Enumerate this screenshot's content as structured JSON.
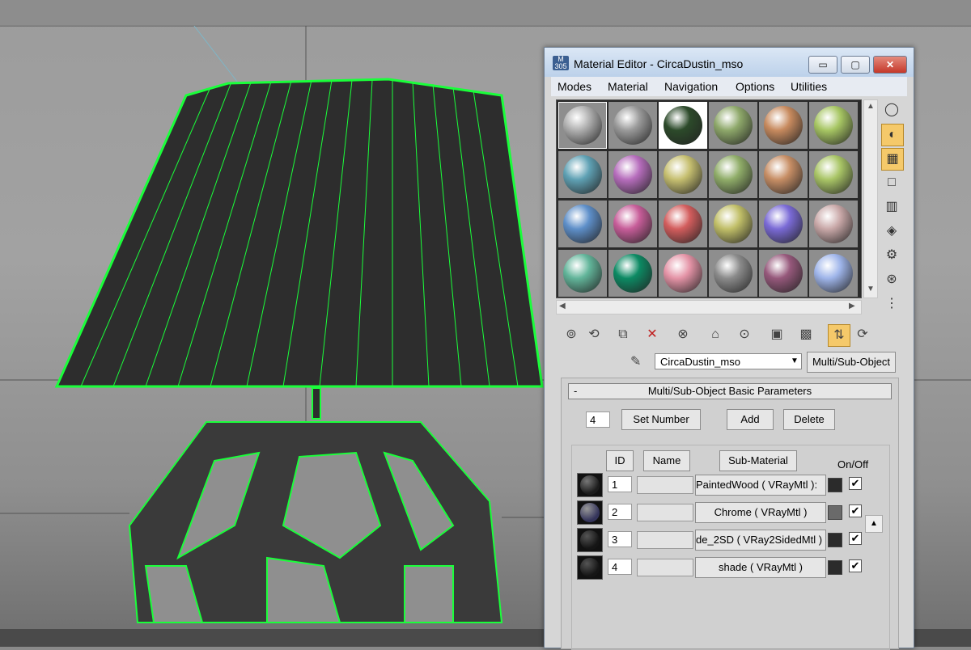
{
  "window": {
    "title": "Material Editor - CircaDustin_mso",
    "icon_label": "M 305",
    "buttons": {
      "minimize": "▭",
      "maximize": "▢",
      "close": "✕"
    }
  },
  "menu": [
    "Modes",
    "Material",
    "Navigation",
    "Options",
    "Utilities"
  ],
  "slots": [
    {
      "color": "#b0b0b0"
    },
    {
      "color": "#9a9a9a"
    },
    {
      "color": "#2c4a2a"
    },
    {
      "color": "#8ea86a"
    },
    {
      "color": "#c78a5e"
    },
    {
      "color": "#a7c663"
    },
    {
      "color": "#5fa1b4"
    },
    {
      "color": "#b66dbc"
    },
    {
      "color": "#c6bf70"
    },
    {
      "color": "#90ad69"
    },
    {
      "color": "#c78e65"
    },
    {
      "color": "#a9c566"
    },
    {
      "color": "#5e8fc9"
    },
    {
      "color": "#c75d99"
    },
    {
      "color": "#d35d5d"
    },
    {
      "color": "#c1bf68"
    },
    {
      "color": "#7a6ad6"
    },
    {
      "color": "#c9a8a8"
    },
    {
      "color": "#62b59a"
    },
    {
      "color": "#0c8a63"
    },
    {
      "color": "#e493a6"
    },
    {
      "color": "#8b8b8b"
    },
    {
      "color": "#96587b"
    },
    {
      "color": "#9fb5ea"
    }
  ],
  "material_name": "CircaDustin_mso",
  "material_type": "Multi/Sub-Object",
  "rollout": {
    "title": "Multi/Sub-Object Basic Parameters",
    "collapse": "-",
    "count": "4",
    "set_number": "Set Number",
    "add": "Add",
    "delete": "Delete",
    "columns": {
      "id": "ID",
      "name": "Name",
      "sub_material": "Sub-Material",
      "on_off": "On/Off"
    },
    "rows": [
      {
        "id": "1",
        "name": "",
        "sub": ":PaintedWood  ( VRayMtl )",
        "swatch": "#2b2b2b",
        "on": "✔"
      },
      {
        "id": "2",
        "name": "",
        "sub": "Chrome  ( VRayMtl )",
        "swatch": "#6a6a6a",
        "on": "✔"
      },
      {
        "id": "3",
        "name": "",
        "sub": "de_2SD  ( VRay2SidedMtl )",
        "swatch": "#2b2b2b",
        "on": "✔"
      },
      {
        "id": "4",
        "name": "",
        "sub": "shade  ( VRayMtl )",
        "swatch": "#2b2b2b",
        "on": "✔"
      }
    ]
  },
  "icons": {
    "side_toolbar": [
      "sample-sphere-icon",
      "backlight-icon",
      "checker-background-icon",
      "sample-uv-icon",
      "video-color-check-icon",
      "make-preview-icon",
      "options-icon",
      "select-by-material-icon",
      "material-navigator-icon"
    ],
    "bottom_toolbar": [
      "get-material-icon",
      "put-to-scene-icon",
      "assign-material-icon",
      "reset-map-icon",
      "make-unique-icon",
      "put-to-library-icon",
      "material-effects-channel-icon",
      "show-shaded-material-icon",
      "show-end-result-icon",
      "go-to-parent-icon",
      "go-forward-icon"
    ]
  }
}
